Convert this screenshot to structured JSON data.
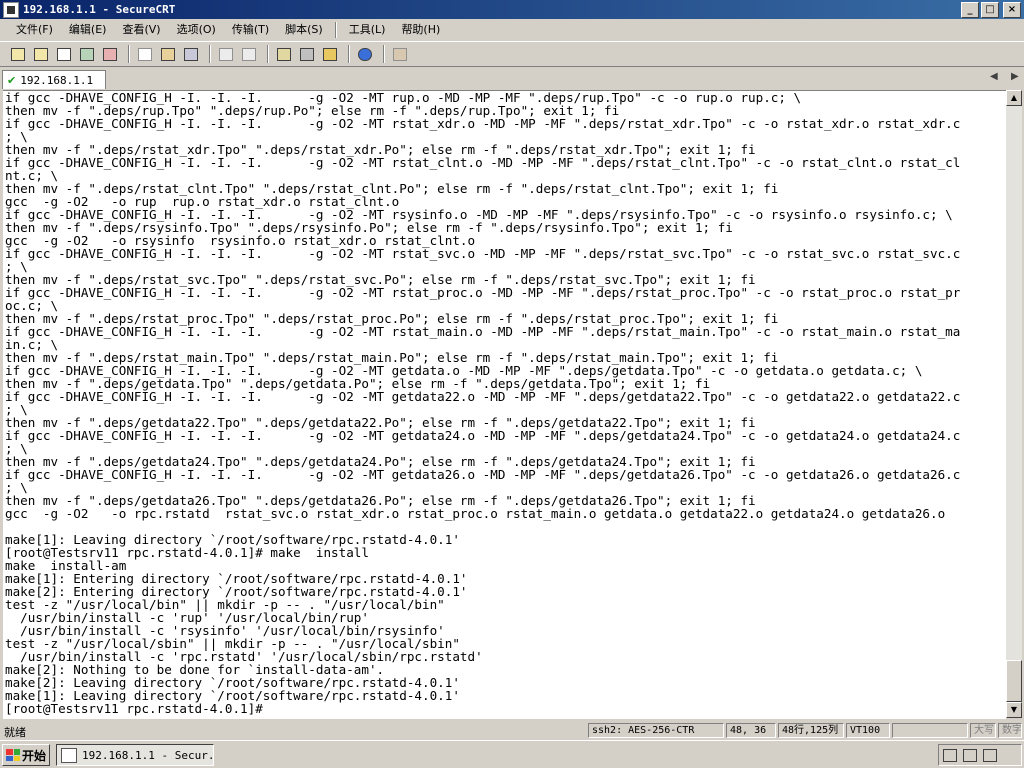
{
  "window": {
    "title": "192.168.1.1 - SecureCRT",
    "controls": [
      "_",
      "□",
      "×"
    ]
  },
  "menu": [
    "文件(F)",
    "编辑(E)",
    "查看(V)",
    "选项(O)",
    "传输(T)",
    "脚本(S)",
    "工具(L)",
    "帮助(H)"
  ],
  "toolbar": {
    "icons": [
      "connect-icon",
      "quick-connect-icon",
      "connect-tab-icon",
      "reconnect-icon",
      "disconnect-icon",
      "copy-icon",
      "paste-icon",
      "find-icon",
      "print-icon",
      "print-setup-icon",
      "session-options-icon",
      "global-options-icon",
      "keymap-icon",
      "help-icon",
      "sftp-icon"
    ]
  },
  "tab": {
    "label": "192.168.1.1"
  },
  "terminal": {
    "lines": [
      "if gcc -DHAVE_CONFIG_H -I. -I. -I.      -g -O2 -MT rup.o -MD -MP -MF \".deps/rup.Tpo\" -c -o rup.o rup.c; \\",
      "then mv -f \".deps/rup.Tpo\" \".deps/rup.Po\"; else rm -f \".deps/rup.Tpo\"; exit 1; fi",
      "if gcc -DHAVE_CONFIG_H -I. -I. -I.      -g -O2 -MT rstat_xdr.o -MD -MP -MF \".deps/rstat_xdr.Tpo\" -c -o rstat_xdr.o rstat_xdr.c",
      "; \\",
      "then mv -f \".deps/rstat_xdr.Tpo\" \".deps/rstat_xdr.Po\"; else rm -f \".deps/rstat_xdr.Tpo\"; exit 1; fi",
      "if gcc -DHAVE_CONFIG_H -I. -I. -I.      -g -O2 -MT rstat_clnt.o -MD -MP -MF \".deps/rstat_clnt.Tpo\" -c -o rstat_clnt.o rstat_cl",
      "nt.c; \\",
      "then mv -f \".deps/rstat_clnt.Tpo\" \".deps/rstat_clnt.Po\"; else rm -f \".deps/rstat_clnt.Tpo\"; exit 1; fi",
      "gcc  -g -O2   -o rup  rup.o rstat_xdr.o rstat_clnt.o",
      "if gcc -DHAVE_CONFIG_H -I. -I. -I.      -g -O2 -MT rsysinfo.o -MD -MP -MF \".deps/rsysinfo.Tpo\" -c -o rsysinfo.o rsysinfo.c; \\",
      "then mv -f \".deps/rsysinfo.Tpo\" \".deps/rsysinfo.Po\"; else rm -f \".deps/rsysinfo.Tpo\"; exit 1; fi",
      "gcc  -g -O2   -o rsysinfo  rsysinfo.o rstat_xdr.o rstat_clnt.o",
      "if gcc -DHAVE_CONFIG_H -I. -I. -I.      -g -O2 -MT rstat_svc.o -MD -MP -MF \".deps/rstat_svc.Tpo\" -c -o rstat_svc.o rstat_svc.c",
      "; \\",
      "then mv -f \".deps/rstat_svc.Tpo\" \".deps/rstat_svc.Po\"; else rm -f \".deps/rstat_svc.Tpo\"; exit 1; fi",
      "if gcc -DHAVE_CONFIG_H -I. -I. -I.      -g -O2 -MT rstat_proc.o -MD -MP -MF \".deps/rstat_proc.Tpo\" -c -o rstat_proc.o rstat_pr",
      "oc.c; \\",
      "then mv -f \".deps/rstat_proc.Tpo\" \".deps/rstat_proc.Po\"; else rm -f \".deps/rstat_proc.Tpo\"; exit 1; fi",
      "if gcc -DHAVE_CONFIG_H -I. -I. -I.      -g -O2 -MT rstat_main.o -MD -MP -MF \".deps/rstat_main.Tpo\" -c -o rstat_main.o rstat_ma",
      "in.c; \\",
      "then mv -f \".deps/rstat_main.Tpo\" \".deps/rstat_main.Po\"; else rm -f \".deps/rstat_main.Tpo\"; exit 1; fi",
      "if gcc -DHAVE_CONFIG_H -I. -I. -I.      -g -O2 -MT getdata.o -MD -MP -MF \".deps/getdata.Tpo\" -c -o getdata.o getdata.c; \\",
      "then mv -f \".deps/getdata.Tpo\" \".deps/getdata.Po\"; else rm -f \".deps/getdata.Tpo\"; exit 1; fi",
      "if gcc -DHAVE_CONFIG_H -I. -I. -I.      -g -O2 -MT getdata22.o -MD -MP -MF \".deps/getdata22.Tpo\" -c -o getdata22.o getdata22.c",
      "; \\",
      "then mv -f \".deps/getdata22.Tpo\" \".deps/getdata22.Po\"; else rm -f \".deps/getdata22.Tpo\"; exit 1; fi",
      "if gcc -DHAVE_CONFIG_H -I. -I. -I.      -g -O2 -MT getdata24.o -MD -MP -MF \".deps/getdata24.Tpo\" -c -o getdata24.o getdata24.c",
      "; \\",
      "then mv -f \".deps/getdata24.Tpo\" \".deps/getdata24.Po\"; else rm -f \".deps/getdata24.Tpo\"; exit 1; fi",
      "if gcc -DHAVE_CONFIG_H -I. -I. -I.      -g -O2 -MT getdata26.o -MD -MP -MF \".deps/getdata26.Tpo\" -c -o getdata26.o getdata26.c",
      "; \\",
      "then mv -f \".deps/getdata26.Tpo\" \".deps/getdata26.Po\"; else rm -f \".deps/getdata26.Tpo\"; exit 1; fi",
      "gcc  -g -O2   -o rpc.rstatd  rstat_svc.o rstat_xdr.o rstat_proc.o rstat_main.o getdata.o getdata22.o getdata24.o getdata26.o",
      "",
      "make[1]: Leaving directory `/root/software/rpc.rstatd-4.0.1'",
      "[root@Testsrv11 rpc.rstatd-4.0.1]# make  install",
      "make  install-am",
      "make[1]: Entering directory `/root/software/rpc.rstatd-4.0.1'",
      "make[2]: Entering directory `/root/software/rpc.rstatd-4.0.1'",
      "test -z \"/usr/local/bin\" || mkdir -p -- . \"/usr/local/bin\"",
      "  /usr/bin/install -c 'rup' '/usr/local/bin/rup'",
      "  /usr/bin/install -c 'rsysinfo' '/usr/local/bin/rsysinfo'",
      "test -z \"/usr/local/sbin\" || mkdir -p -- . \"/usr/local/sbin\"",
      "  /usr/bin/install -c 'rpc.rstatd' '/usr/local/sbin/rpc.rstatd'",
      "make[2]: Nothing to be done for `install-data-am'.",
      "make[2]: Leaving directory `/root/software/rpc.rstatd-4.0.1'",
      "make[1]: Leaving directory `/root/software/rpc.rstatd-4.0.1'",
      "[root@Testsrv11 rpc.rstatd-4.0.1]#"
    ]
  },
  "statusbar": {
    "ready": "就绪",
    "cipher": "ssh2: AES-256-CTR",
    "cursor": "48,  36",
    "size": "48行,125列",
    "terminal_type": "VT100",
    "caps": "大写",
    "num": "数字"
  },
  "taskbar": {
    "start": "开始",
    "task": "192.168.1.1 - Secur..."
  }
}
